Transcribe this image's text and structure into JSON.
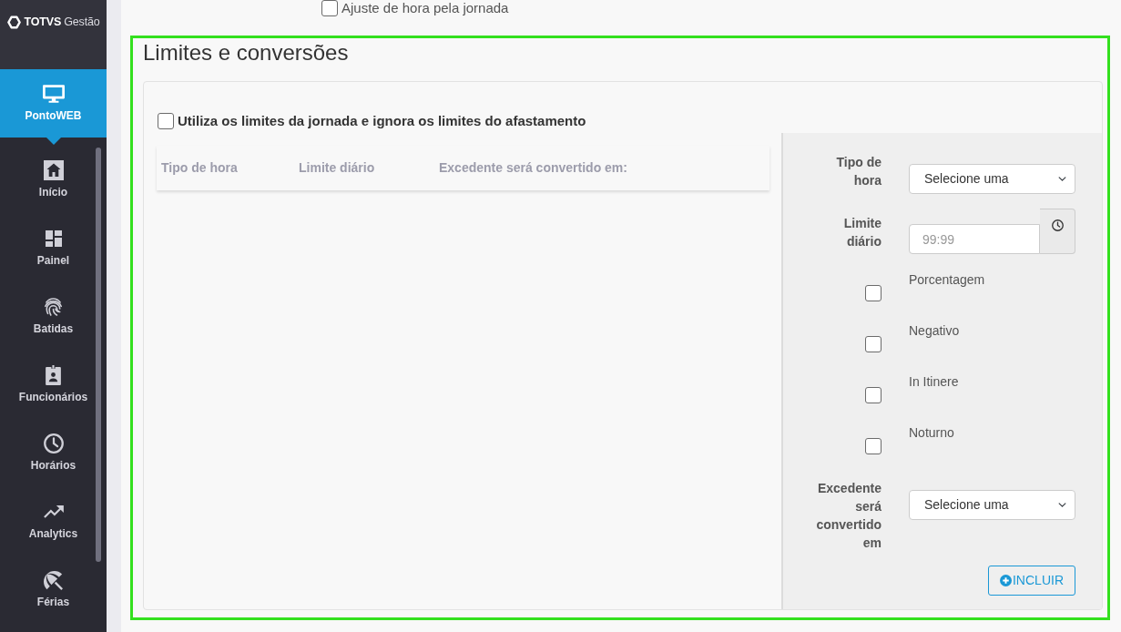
{
  "sidebar": {
    "logo": {
      "brand": "TOTVS",
      "product": "Gestão"
    },
    "items": [
      {
        "label": "PontoWEB",
        "selected": true
      },
      {
        "label": "Início",
        "selected": false
      },
      {
        "label": "Painel",
        "selected": false
      },
      {
        "label": "Batidas",
        "selected": false
      },
      {
        "label": "Funcionários",
        "selected": false
      },
      {
        "label": "Horários",
        "selected": false
      },
      {
        "label": "Analytics",
        "selected": false
      },
      {
        "label": "Férias",
        "selected": false
      }
    ]
  },
  "top_fragment": {
    "label": "Ajuste de hora pela jornada",
    "checked": false
  },
  "section": {
    "title": "Limites e conversões",
    "option": {
      "label": "Utiliza os limites da jornada e ignora os limites do afastamento",
      "checked": false
    },
    "table": {
      "columns": [
        "Tipo de hora",
        "Limite diário",
        "Excedente será convertido em:"
      ]
    },
    "form": {
      "fields": [
        {
          "kind": "select",
          "label": "Tipo de hora",
          "value": "Selecione uma"
        },
        {
          "kind": "time",
          "label": "Limite diário",
          "placeholder": "99:99"
        },
        {
          "kind": "checkbox",
          "label": "Porcentagem",
          "checked": false
        },
        {
          "kind": "checkbox",
          "label": "Negativo",
          "checked": false
        },
        {
          "kind": "checkbox",
          "label": "In Itinere",
          "checked": false
        },
        {
          "kind": "checkbox",
          "label": "Noturno",
          "checked": false
        },
        {
          "kind": "select",
          "label": "Excedente será convertido em",
          "value": "Selecione uma"
        }
      ],
      "submit": {
        "label": "INCLUIR"
      }
    }
  }
}
